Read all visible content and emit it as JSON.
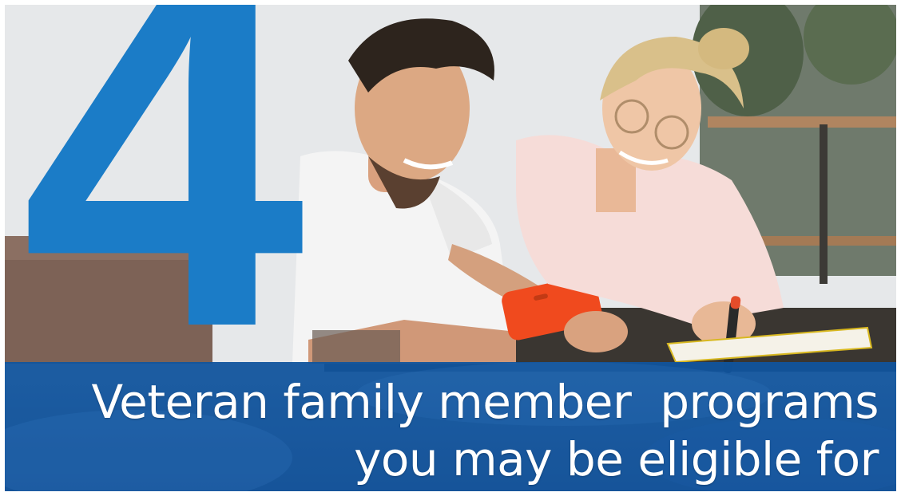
{
  "image": {
    "number": "4",
    "headline_line1": "Veteran family member  programs",
    "headline_line2": "you may be eligible for",
    "colors": {
      "number_blue": "#1b7cc7",
      "banner_blue": "#1056a0",
      "text_white": "#ffffff",
      "phone_orange": "#f04a1e"
    }
  }
}
